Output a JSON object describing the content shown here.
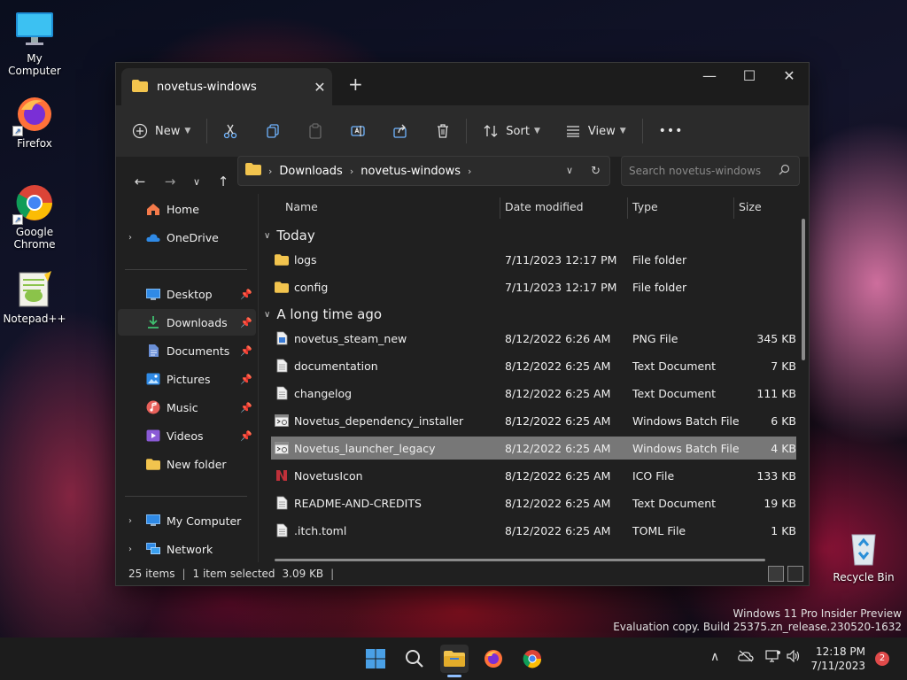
{
  "desktop": {
    "icons": [
      {
        "label": "My Computer",
        "icon": "monitor-icon"
      },
      {
        "label": "Firefox",
        "icon": "firefox-icon"
      },
      {
        "label": "Google Chrome",
        "icon": "chrome-icon"
      },
      {
        "label": "Notepad++",
        "icon": "notepadpp-icon"
      },
      {
        "label": "Recycle Bin",
        "icon": "recycle-bin-icon"
      }
    ],
    "watermark": {
      "line1": "Windows 11 Pro Insider Preview",
      "line2": "Evaluation copy. Build 25375.zn_release.230520-1632"
    }
  },
  "window": {
    "tab_title": "novetus-windows",
    "new_tab": "+",
    "controls": {
      "minimize": "—",
      "maximize": "☐",
      "close": "✕"
    },
    "toolbar": {
      "new_label": "New",
      "sort_label": "Sort",
      "view_label": "View",
      "more_label": "•••"
    },
    "address": {
      "crumbs": [
        "Downloads",
        "novetus-windows"
      ],
      "search_placeholder": "Search novetus-windows"
    },
    "nav": {
      "items": [
        {
          "label": "Home",
          "icon": "home-icon",
          "pinned": false
        },
        {
          "label": "OneDrive",
          "icon": "onedrive-icon",
          "pinned": false,
          "expandable": true
        },
        {
          "label": "Desktop",
          "icon": "desktop-folder-icon",
          "pinned": true
        },
        {
          "label": "Downloads",
          "icon": "downloads-icon",
          "pinned": true,
          "selected": true
        },
        {
          "label": "Documents",
          "icon": "documents-icon",
          "pinned": true
        },
        {
          "label": "Pictures",
          "icon": "pictures-icon",
          "pinned": true
        },
        {
          "label": "Music",
          "icon": "music-icon",
          "pinned": true
        },
        {
          "label": "Videos",
          "icon": "videos-icon",
          "pinned": true
        },
        {
          "label": "New folder",
          "icon": "folder-icon",
          "pinned": false
        },
        {
          "label": "My Computer",
          "icon": "computer-icon",
          "pinned": false,
          "expandable": true
        },
        {
          "label": "Network",
          "icon": "network-icon",
          "pinned": false,
          "expandable": true
        }
      ]
    },
    "columns": {
      "name": "Name",
      "date": "Date modified",
      "type": "Type",
      "size": "Size"
    },
    "groups": {
      "today": "Today",
      "longago": "A long time ago"
    },
    "files_today": [
      {
        "name": "logs",
        "date": "7/11/2023 12:17 PM",
        "type": "File folder",
        "size": "",
        "icon": "folder-icon"
      },
      {
        "name": "config",
        "date": "7/11/2023 12:17 PM",
        "type": "File folder",
        "size": "",
        "icon": "folder-icon"
      }
    ],
    "files_old": [
      {
        "name": "novetus_steam_new",
        "date": "8/12/2022 6:26 AM",
        "type": "PNG File",
        "size": "345 KB",
        "icon": "png-file-icon"
      },
      {
        "name": "documentation",
        "date": "8/12/2022 6:25 AM",
        "type": "Text Document",
        "size": "7 KB",
        "icon": "text-file-icon"
      },
      {
        "name": "changelog",
        "date": "8/12/2022 6:25 AM",
        "type": "Text Document",
        "size": "111 KB",
        "icon": "text-file-icon"
      },
      {
        "name": "Novetus_dependency_installer",
        "date": "8/12/2022 6:25 AM",
        "type": "Windows Batch File",
        "size": "6 KB",
        "icon": "batch-file-icon"
      },
      {
        "name": "Novetus_launcher_legacy",
        "date": "8/12/2022 6:25 AM",
        "type": "Windows Batch File",
        "size": "4 KB",
        "icon": "batch-file-icon",
        "selected": true
      },
      {
        "name": "NovetusIcon",
        "date": "8/12/2022 6:25 AM",
        "type": "ICO File",
        "size": "133 KB",
        "icon": "ico-file-icon"
      },
      {
        "name": "README-AND-CREDITS",
        "date": "8/12/2022 6:25 AM",
        "type": "Text Document",
        "size": "19 KB",
        "icon": "text-file-icon"
      },
      {
        "name": ".itch.toml",
        "date": "8/12/2022 6:25 AM",
        "type": "TOML File",
        "size": "1 KB",
        "icon": "text-file-icon"
      }
    ],
    "status": {
      "items": "25 items",
      "selected": "1 item selected",
      "size": "3.09 KB"
    }
  },
  "taskbar": {
    "apps": [
      "start-icon",
      "search-icon",
      "file-explorer-icon",
      "firefox-icon",
      "chrome-icon"
    ],
    "clock_time": "12:18 PM",
    "clock_date": "7/11/2023",
    "notifications": "2"
  },
  "colors": {
    "window_bg": "#202020",
    "toolbar_bg": "#2b2b2b",
    "selection": "#777777",
    "folder": "#f2c44e",
    "accent": "#4aa0e6"
  }
}
